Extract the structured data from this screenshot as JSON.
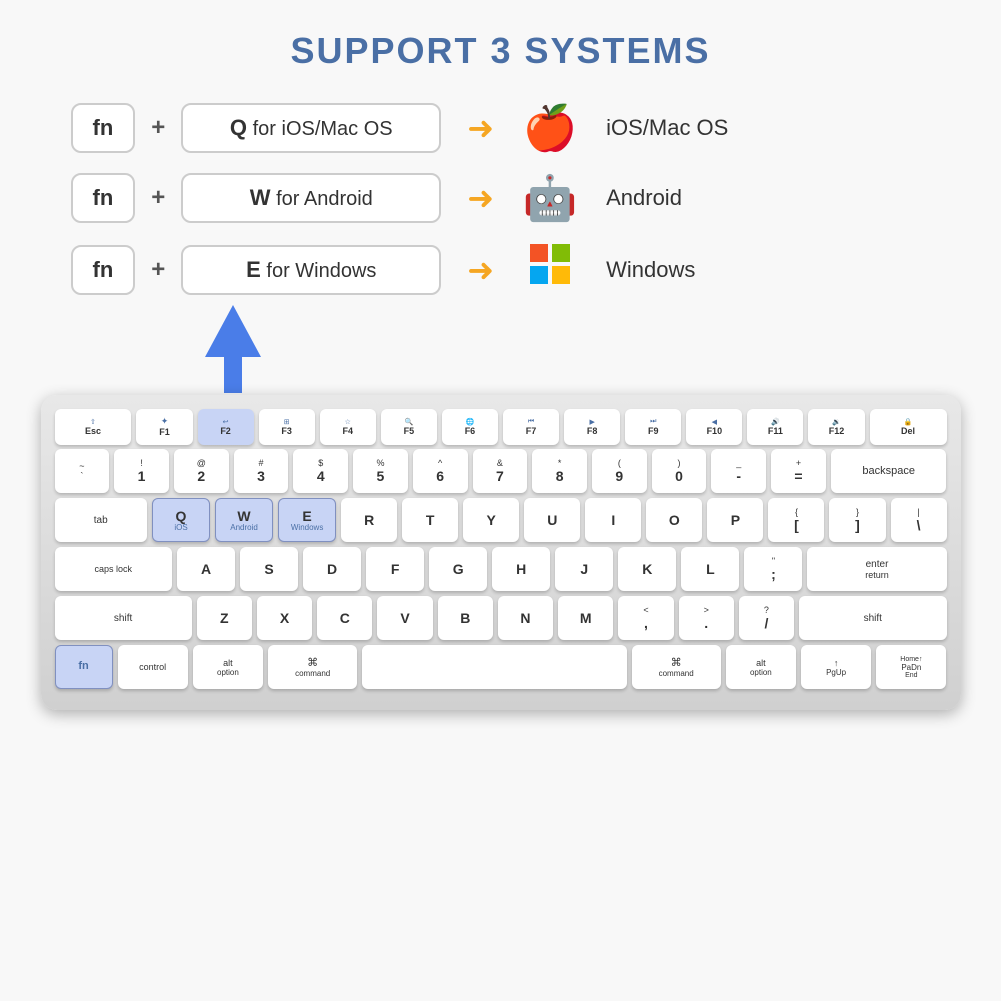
{
  "header": {
    "title": "SUPPORT 3 SYSTEMS"
  },
  "shortcuts": [
    {
      "fn": "fn",
      "plus": "+",
      "combo": "Q for iOS/Mac OS",
      "os_label": "iOS/Mac OS",
      "os_icon": "apple"
    },
    {
      "fn": "fn",
      "plus": "+",
      "combo": "W for Android",
      "os_label": "Android",
      "os_icon": "android"
    },
    {
      "fn": "fn",
      "plus": "+",
      "combo": "E for Windows",
      "os_label": "Windows",
      "os_icon": "windows"
    }
  ],
  "keyboard": {
    "rows": [
      [
        "fn_row"
      ],
      [
        "number_row"
      ],
      [
        "qwerty_row"
      ],
      [
        "asdf_row"
      ],
      [
        "zxcv_row"
      ],
      [
        "bottom_row"
      ]
    ]
  },
  "keys": {
    "q_label": "Q",
    "q_sub": "iOS",
    "w_label": "W",
    "w_sub": "Android",
    "e_label": "E",
    "e_sub": "Windows",
    "fn_label": "fn",
    "option_label": "option"
  }
}
